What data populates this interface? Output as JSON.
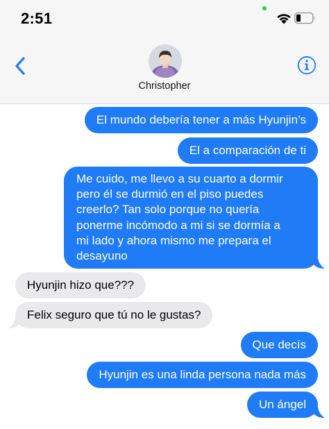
{
  "status_bar": {
    "time": "2:51"
  },
  "colors": {
    "sent_bubble": "#1f7bf6",
    "received_bubble": "#e9e9eb",
    "accent": "#1f7bf6",
    "status_dot": "#33c759"
  },
  "conversation": {
    "contact_name": "Christopher"
  },
  "messages": [
    {
      "from": "me",
      "text": "El mundo debería tener a más Hyunjin’s"
    },
    {
      "from": "me",
      "text": "El a comparación de ti"
    },
    {
      "from": "me",
      "lines": [
        "Me cuido, me llevo a su cuarto a dormir",
        "pero él se durmió en el piso puedes",
        "creerlo? Tan solo porque no quería",
        "ponerme incómodo a mi si se dormía a",
        "mi lado y ahora mismo me prepara el",
        "desayuno"
      ]
    },
    {
      "from": "them",
      "text": "Hyunjin hizo que???"
    },
    {
      "from": "them",
      "text": "Felix seguro que tú no le gustas?"
    },
    {
      "from": "me",
      "text": "Que decís"
    },
    {
      "from": "me",
      "text": "Hyunjin es una linda persona nada más"
    },
    {
      "from": "me",
      "text": "Un ángel"
    }
  ]
}
